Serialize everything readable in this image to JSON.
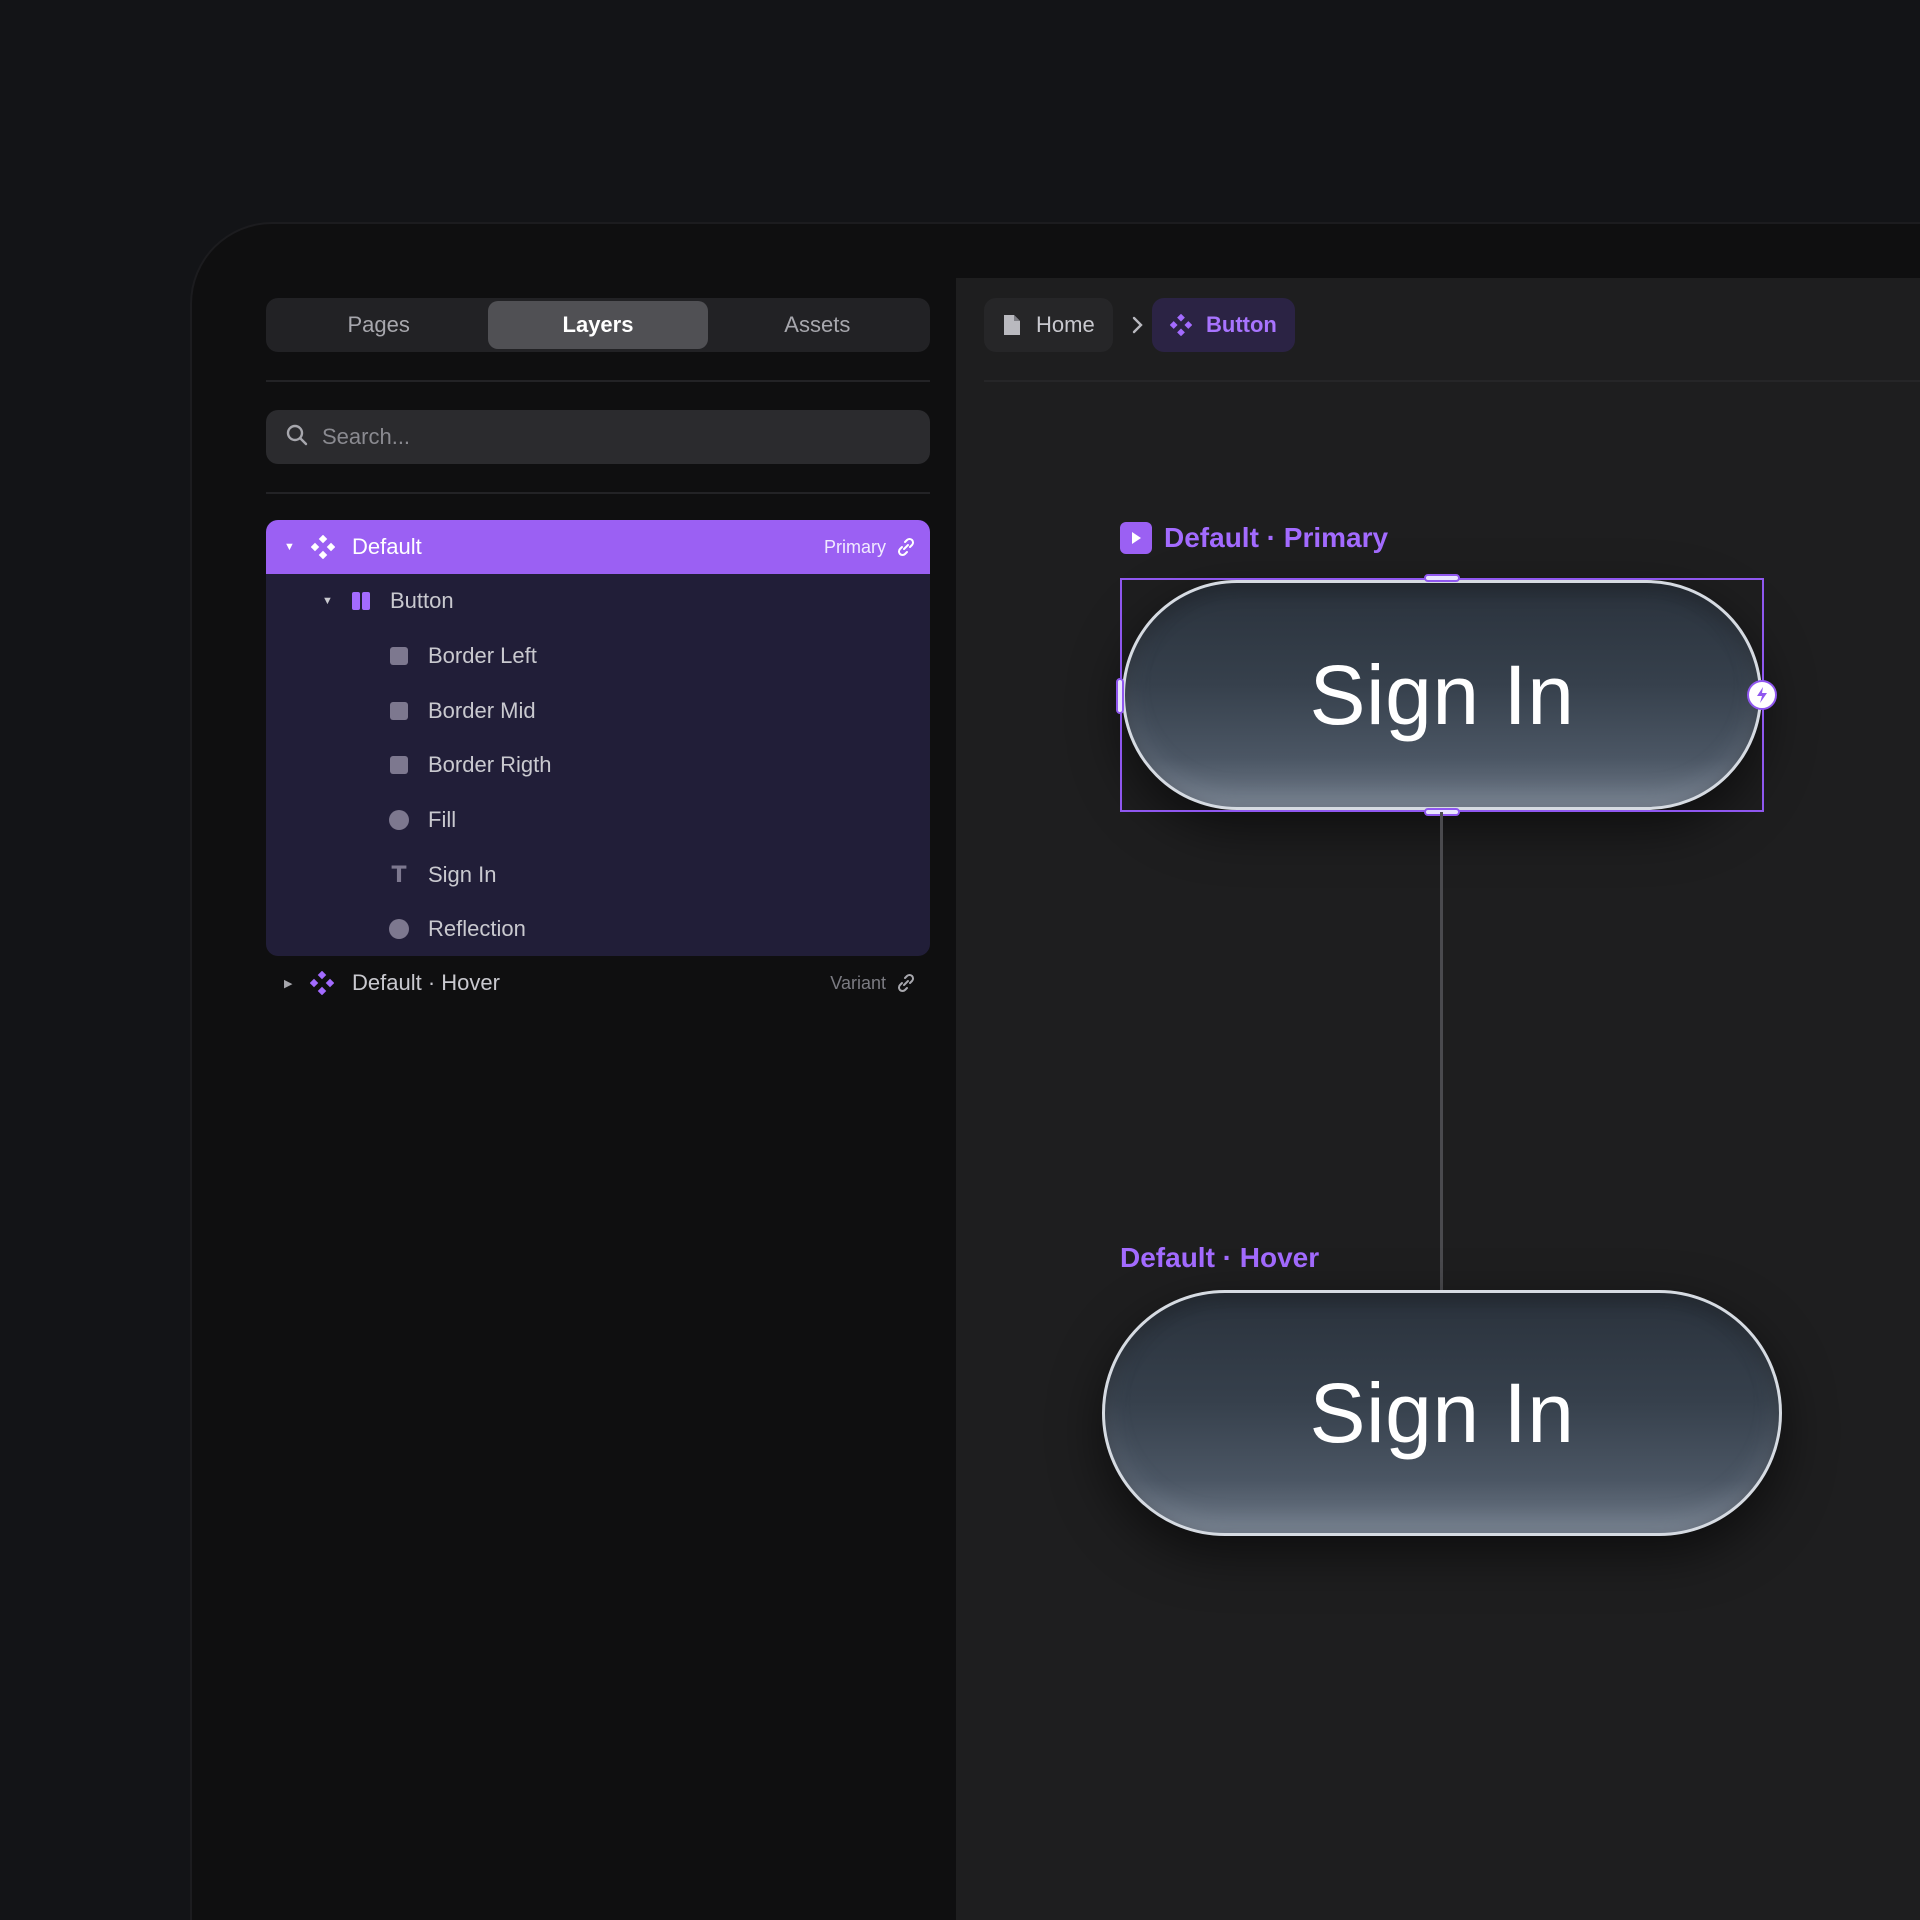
{
  "tabs": [
    "Pages",
    "Layers",
    "Assets"
  ],
  "active_tab": "Layers",
  "search": {
    "placeholder": "Search..."
  },
  "layers": {
    "selected": {
      "label": "Default",
      "badge": "Primary"
    },
    "button": {
      "label": "Button"
    },
    "children": [
      "Border Left",
      "Border Mid",
      "Border Rigth",
      "Fill",
      "Sign In",
      "Reflection"
    ],
    "hover": {
      "label": "Default · Hover",
      "badge": "Variant"
    }
  },
  "breadcrumb": {
    "home": "Home",
    "current": "Button"
  },
  "canvas": {
    "primary_frame_label": "Default · Primary",
    "hover_frame_label": "Default · Hover",
    "button_text": "Sign In"
  },
  "colors": {
    "accent": "#9b60f3",
    "accent_text": "#a36bff",
    "group_bg": "#211e38"
  },
  "icons": {
    "search": "search-icon",
    "component": "component-icon",
    "link": "link-icon",
    "file": "file-icon",
    "chevron": "chevron-right-icon",
    "play": "play-icon",
    "bolt": "bolt-icon"
  }
}
